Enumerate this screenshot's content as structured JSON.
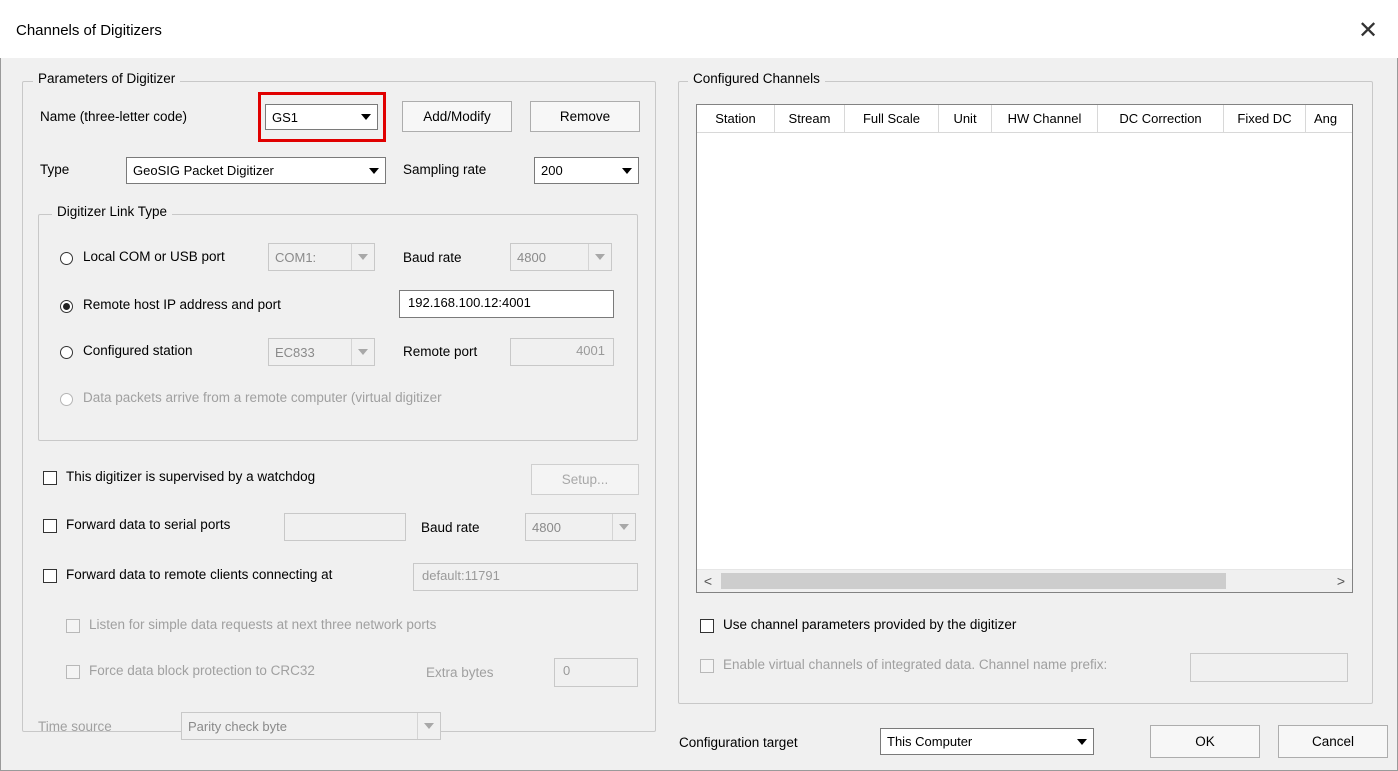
{
  "window": {
    "title": "Channels of Digitizers"
  },
  "params": {
    "legend": "Parameters of Digitizer",
    "name_label": "Name (three-letter code)",
    "name_value": "GS1",
    "add_modify": "Add/Modify",
    "remove": "Remove",
    "type_label": "Type",
    "type_value": "GeoSIG Packet Digitizer",
    "sampling_label": "Sampling rate",
    "sampling_value": "200"
  },
  "link": {
    "legend": "Digitizer Link Type",
    "local_label": "Local COM or USB port",
    "com_value": "COM1:",
    "baud_label": "Baud rate",
    "baud_value": "4800",
    "remote_label": "Remote host IP address and port",
    "remote_value": "192.168.100.12:4001",
    "configured_label": "Configured station",
    "station_value": "EC833",
    "remote_port_label": "Remote port",
    "remote_port_value": "4001",
    "virtual_label": "Data packets arrive from a remote computer (virtual digitizer",
    "selected": "remote"
  },
  "options": {
    "watchdog_label": "This digitizer is supervised by a watchdog",
    "setup_label": "Setup...",
    "serial_label": "Forward data to serial ports",
    "serial_value": "",
    "serial_baud_label": "Baud rate",
    "serial_baud_value": "4800",
    "clients_label": "Forward data to remote clients connecting at",
    "clients_value": "default:11791",
    "listen_label": "Listen for simple data requests at next three network ports",
    "crc_label": "Force data block protection to CRC32",
    "extra_label": "Extra bytes",
    "extra_value": "0",
    "time_source_label": "Time source",
    "time_source_value": "Parity check byte"
  },
  "channels": {
    "legend": "Configured Channels",
    "columns": [
      "Station",
      "Stream",
      "Full Scale",
      "Unit",
      "HW Channel",
      "DC Correction",
      "Fixed DC",
      "Ang"
    ],
    "rows": [],
    "use_params_label": "Use channel parameters provided by the digitizer",
    "virtual_label": "Enable virtual channels of integrated data. Channel name prefix:",
    "prefix_value": ""
  },
  "footer": {
    "target_label": "Configuration target",
    "target_value": "This Computer",
    "ok": "OK",
    "cancel": "Cancel"
  },
  "colors": {
    "highlight": "#e00000",
    "window_bg": "#f0f0f0",
    "disabled_text": "#a0a0a0"
  },
  "icons": [
    "close-icon",
    "dropdown-arrow-icon",
    "scroll-left-icon",
    "scroll-right-icon"
  ]
}
